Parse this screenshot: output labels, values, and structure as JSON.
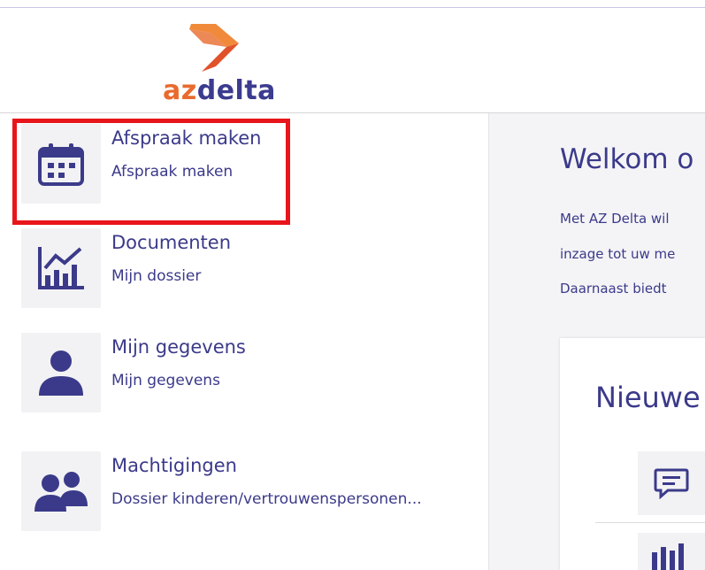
{
  "brand": {
    "logo_az": "az",
    "logo_delta": "delta",
    "colors": {
      "orange": "#e96a2d",
      "purple": "#3b3a8a",
      "highlight": "#e8151b"
    }
  },
  "nav": {
    "items": [
      {
        "title": "Afspraak maken",
        "subtitle": "Afspraak maken",
        "icon": "calendar-icon"
      },
      {
        "title": "Documenten",
        "subtitle": "Mijn dossier",
        "icon": "chart-icon"
      },
      {
        "title": "Mijn gegevens",
        "subtitle": "Mijn gegevens",
        "icon": "user-icon"
      },
      {
        "title": "Machtigingen",
        "subtitle": "Dossier kinderen/vertrouwenspersonen...",
        "icon": "users-icon"
      }
    ]
  },
  "main": {
    "welcome_title": "Welkom o",
    "welcome_lines": [
      "Met AZ Delta wil",
      "inzage tot uw me",
      "Daarnaast biedt"
    ],
    "card_title": "Nieuwe",
    "card_icons": [
      "chat-icon",
      "chart-icon"
    ]
  }
}
